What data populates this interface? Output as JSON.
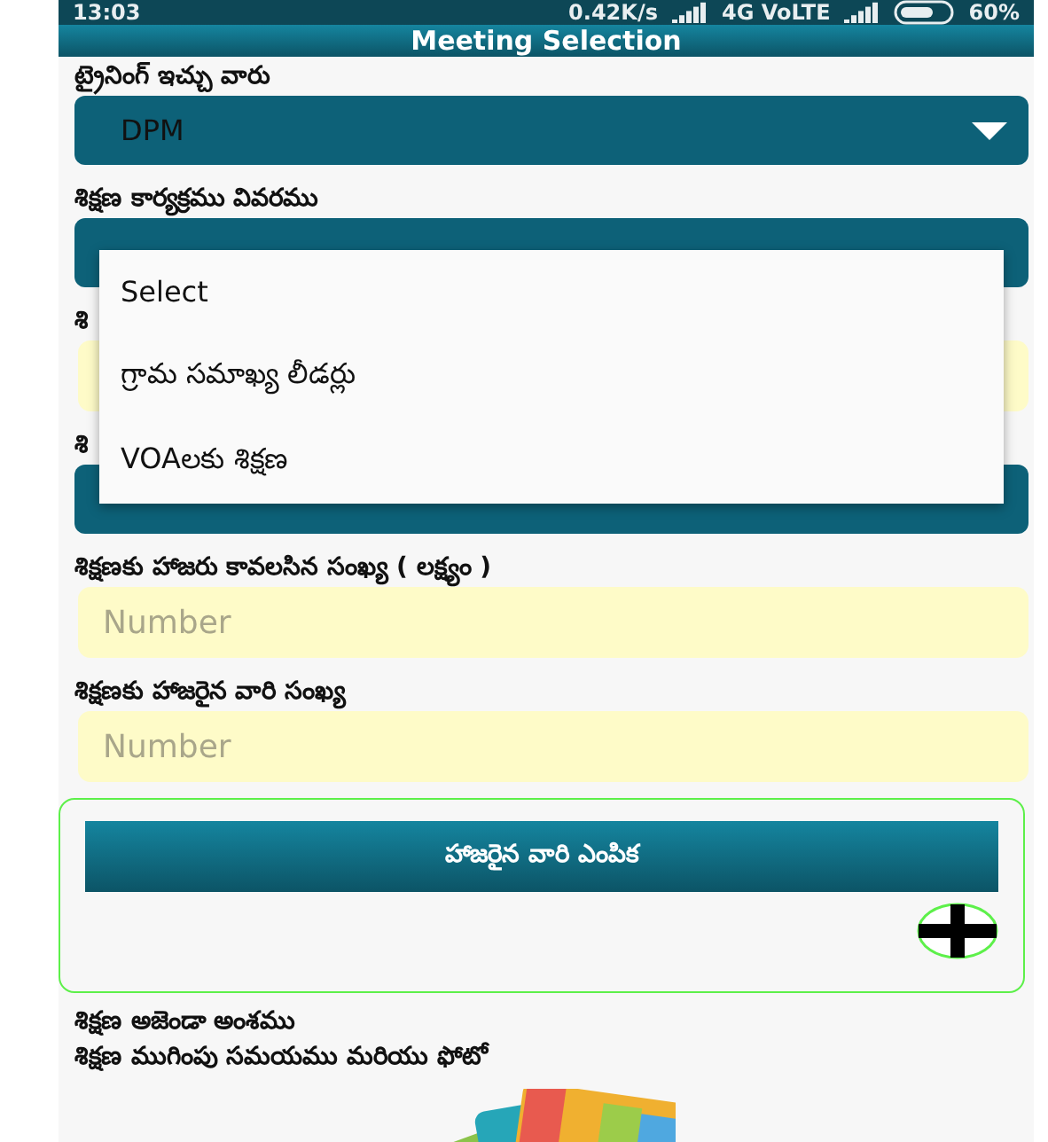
{
  "status_bar": {
    "time": "13:03",
    "speed": "0.42K/s",
    "network": "4G VoLTE",
    "battery": "60%"
  },
  "title": "Meeting Selection",
  "fields": [
    {
      "kind": "dropdown",
      "label": "ట్రైనింగ్ ఇచ్చు వారు",
      "value": "DPM"
    },
    {
      "kind": "dropdown",
      "label": "శిక్షణ కార్యక్రము వివరము"
    },
    {
      "kind": "number",
      "label": "శి"
    },
    {
      "kind": "dropdown",
      "label": "శి"
    },
    {
      "kind": "number",
      "label": "శిక్షణకు హాజరు కావలసిన సంఖ్య ( లక్ష్యం )",
      "placeholder": "Number"
    },
    {
      "kind": "number",
      "label": "శిక్షణకు హాజరైన వారి సంఖ్య",
      "placeholder": "Number"
    }
  ],
  "attendee_card": {
    "button": "హాజరైన వారి ఎంపిక"
  },
  "notes": [
    "శిక్షణ అజెండా అంశము",
    "శిక్షణ ముగింపు సమయము మరియు ఫోటో"
  ],
  "popup": {
    "options": [
      {
        "label": "Select",
        "selected": false
      },
      {
        "label": "గ్రామ సమాఖ్య లీడర్లు",
        "selected": false
      },
      {
        "label": "VOAలకు శిక్షణ",
        "selected": false
      }
    ]
  }
}
